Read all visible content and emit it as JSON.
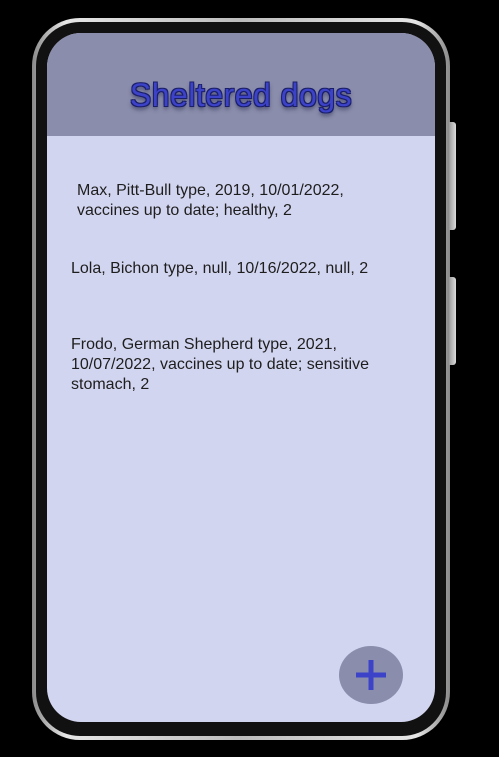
{
  "app": {
    "title": "Sheltered dogs"
  },
  "dogs": [
    {
      "text": "Max, Pitt-Bull type, 2019, 10/01/2022, vaccines up to date; healthy, 2"
    },
    {
      "text": "Lola, Bichon type, null, 10/16/2022, null, 2"
    },
    {
      "text": "Frodo, German Shepherd type, 2021, 10/07/2022, vaccines up to date; sensitive stomach, 2"
    }
  ],
  "fab": {
    "icon": "plus-icon",
    "color": "#3d43c9"
  },
  "colors": {
    "header_bg": "#8a8dab",
    "screen_bg": "#d2d5f0",
    "title_color": "#3d43c9"
  }
}
